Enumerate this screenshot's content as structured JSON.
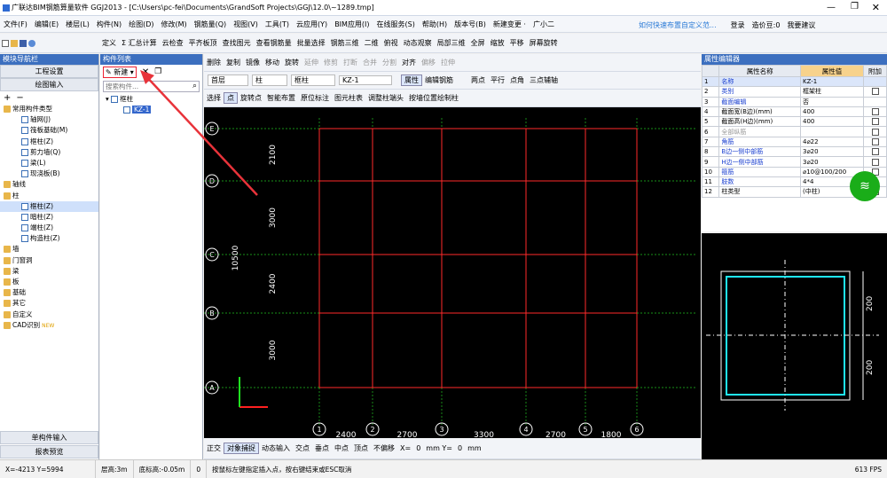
{
  "title": "广联达BIM钢筋算量软件 GGJ2013 - [C:\\Users\\pc-fei\\Documents\\GrandSoft Projects\\GGJ\\12.0\\~1289.tmp]",
  "menu": [
    "文件(F)",
    "编辑(E)",
    "楼层(L)",
    "构件(N)",
    "绘图(D)",
    "修改(M)",
    "钢筋量(Q)",
    "视图(V)",
    "工具(T)",
    "云应用(Y)",
    "BIM应用(I)",
    "在线服务(S)",
    "帮助(H)",
    "版本号(B)",
    "新建变更 ·",
    "广小二"
  ],
  "menu_right": {
    "tip": "如何快速布置自定义范...",
    "login": "登录",
    "points": "造价豆:0",
    "suggest": "我要建议"
  },
  "toolbar1": [
    "定义",
    "Σ 汇总计算",
    "云检查",
    "平齐板顶",
    "查找图元",
    "查看钢筋量",
    "批量选择",
    "钢筋三维",
    "二维",
    "俯视",
    "动态观察",
    "局部三维",
    "全屏",
    "缩放",
    "平移",
    "屏幕旋转"
  ],
  "toolbar2": [
    "删除",
    "复制",
    "镜像",
    "移动",
    "旋转",
    "延伸",
    "修剪",
    "打断",
    "合并",
    "分割",
    "对齐",
    "偏移",
    "拉伸"
  ],
  "toolbar3": {
    "floor": "首层",
    "type": "柱",
    "subtype": "框柱",
    "name": "KZ-1",
    "btns": [
      "属性",
      "编辑钢筋"
    ],
    "right": [
      "两点",
      "平行",
      "点角",
      "三点辅轴"
    ]
  },
  "toolbar4": [
    "选择",
    "点",
    "旋转点",
    "智能布置",
    "原位标注",
    "图元柱表",
    "调整柱端头",
    "按墙位置绘制柱"
  ],
  "left_panel": {
    "header": "模块导航栏",
    "pin": "ᵠ ×",
    "btn1": "工程设置",
    "btn2": "绘图输入",
    "tree": [
      {
        "t": "常用构件类型",
        "lvl": 0,
        "f": 1
      },
      {
        "t": "轴网(J)",
        "lvl": 2,
        "f": 0
      },
      {
        "t": "筏板基础(M)",
        "lvl": 2,
        "f": 0
      },
      {
        "t": "框柱(Z)",
        "lvl": 2,
        "f": 0
      },
      {
        "t": "剪力墙(Q)",
        "lvl": 2,
        "f": 0
      },
      {
        "t": "梁(L)",
        "lvl": 2,
        "f": 0
      },
      {
        "t": "现浇板(B)",
        "lvl": 2,
        "f": 0
      },
      {
        "t": "轴线",
        "lvl": 0,
        "f": 1
      },
      {
        "t": "柱",
        "lvl": 0,
        "f": 1
      },
      {
        "t": "框柱(Z)",
        "lvl": 2,
        "f": 0,
        "sel": 1
      },
      {
        "t": "暗柱(Z)",
        "lvl": 2,
        "f": 0
      },
      {
        "t": "端柱(Z)",
        "lvl": 2,
        "f": 0
      },
      {
        "t": "构造柱(Z)",
        "lvl": 2,
        "f": 0
      },
      {
        "t": "墙",
        "lvl": 0,
        "f": 1
      },
      {
        "t": "门窗洞",
        "lvl": 0,
        "f": 1
      },
      {
        "t": "梁",
        "lvl": 0,
        "f": 1
      },
      {
        "t": "板",
        "lvl": 0,
        "f": 1
      },
      {
        "t": "基础",
        "lvl": 0,
        "f": 1
      },
      {
        "t": "其它",
        "lvl": 0,
        "f": 1
      },
      {
        "t": "自定义",
        "lvl": 0,
        "f": 1
      },
      {
        "t": "CAD识别",
        "lvl": 0,
        "f": 1,
        "new": "NEW"
      }
    ],
    "bottom1": "单构件输入",
    "bottom2": "报表预览"
  },
  "comp_list": {
    "header": "构件列表",
    "new_btn": "新建",
    "search_placeholder": "搜索构件...",
    "root": "框柱",
    "item": "KZ-1"
  },
  "canvas": {
    "axes_left": [
      "E",
      "D",
      "C",
      "B",
      "A"
    ],
    "axes_bottom": [
      "1",
      "2",
      "3",
      "4",
      "5",
      "6"
    ],
    "dims_left": [
      "2100",
      "3000",
      "2400",
      "3000"
    ],
    "total": "10500",
    "dims_bottom": [
      "2400",
      "2700",
      "3300",
      "2700",
      "1800"
    ]
  },
  "props": {
    "header": "属性编辑器",
    "cols": [
      "属性名称",
      "属性值",
      "附加"
    ],
    "rows": [
      [
        "1",
        "名称",
        "KZ-1",
        "",
        "blue",
        0
      ],
      [
        "2",
        "类别",
        "框架柱",
        "",
        "blue",
        1
      ],
      [
        "3",
        "截面编辑",
        "否",
        "",
        "blue",
        0
      ],
      [
        "4",
        "截面宽(B边)(mm)",
        "400",
        "",
        "",
        1
      ],
      [
        "5",
        "截面高(H边)(mm)",
        "400",
        "",
        "",
        1
      ],
      [
        "6",
        "全部纵筋",
        "",
        "",
        "gray",
        1
      ],
      [
        "7",
        "角筋",
        "4⌀22",
        "",
        "blue",
        1
      ],
      [
        "8",
        "B边一侧中部筋",
        "3⌀20",
        "",
        "blue",
        1
      ],
      [
        "9",
        "H边一侧中部筋",
        "3⌀20",
        "",
        "blue",
        1
      ],
      [
        "10",
        "箍筋",
        "⌀10@100/200",
        "",
        "blue",
        1
      ],
      [
        "11",
        "肢数",
        "4*4",
        "",
        "blue",
        0
      ],
      [
        "12",
        "柱类型",
        "(中柱)",
        "",
        "",
        1
      ]
    ]
  },
  "section": {
    "dim1": "200",
    "dim2": "200"
  },
  "snap": [
    "正交",
    "对象捕捉",
    "动态输入",
    "交点",
    "垂点",
    "中点",
    "顶点",
    "不偏移",
    "X=",
    "0",
    "mm Y=",
    "0",
    "mm"
  ],
  "status": {
    "coord": "X=-4213 Y=5994",
    "height": "层高:3m",
    "bottom": "底标高:-0.05m",
    "val": "0",
    "hint": "按鼠标左键指定插入点，按右键结束或ESC取消",
    "fps": "613 FPS"
  },
  "colors": {
    "accent": "#3c6fbf",
    "grid": "#ff2a2a",
    "axis": "#22c022"
  }
}
